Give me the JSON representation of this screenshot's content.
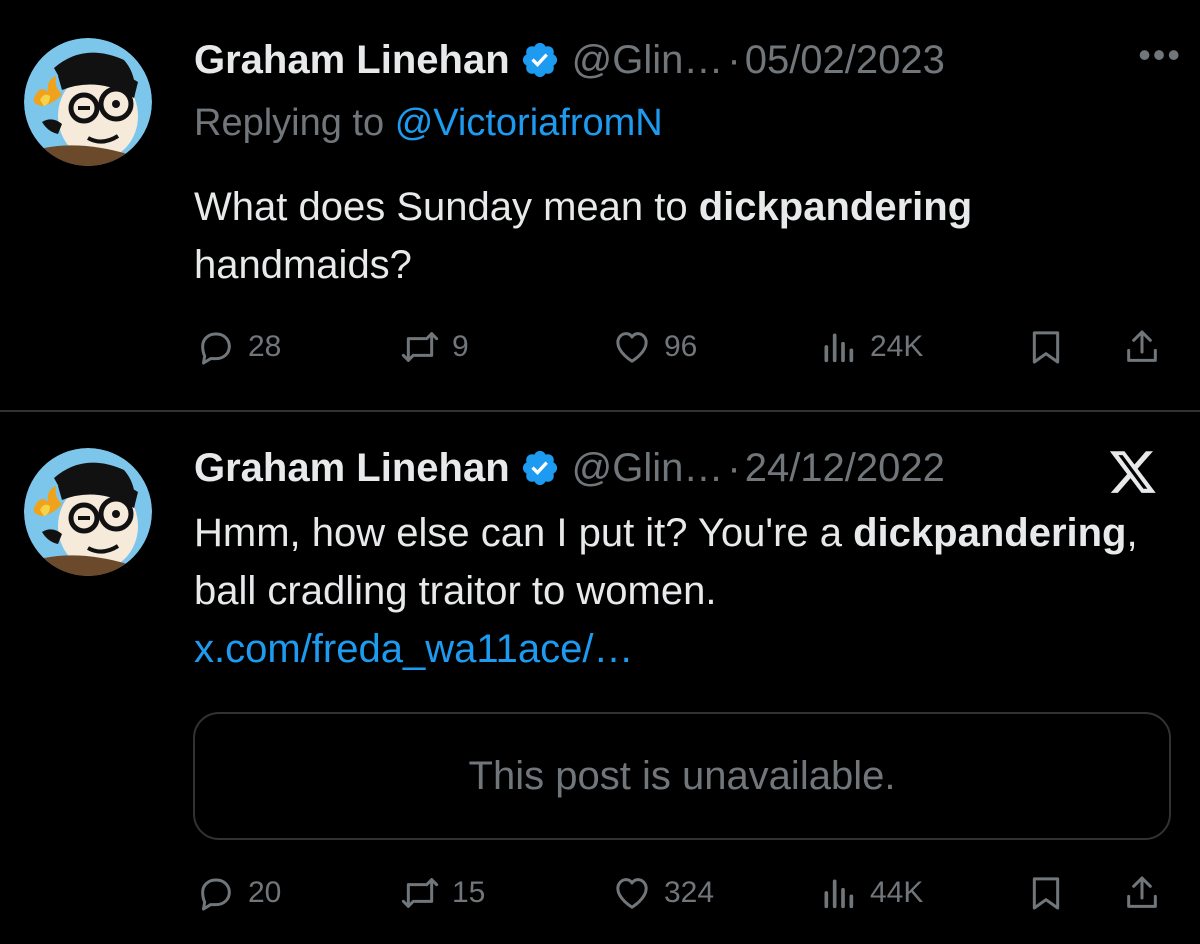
{
  "tweets": [
    {
      "author": "Graham Linehan",
      "handle": "@Glin…",
      "separator": "·",
      "date": "05/02/2023",
      "more_label": "•••",
      "reply_prefix": "Replying to",
      "reply_to": "@VictoriafromN",
      "text_before": "What does Sunday mean to ",
      "text_bold": "dickpandering",
      "text_after": " handmaids?",
      "stats": {
        "replies": "28",
        "reposts": "9",
        "likes": "96",
        "views": "24K"
      }
    },
    {
      "author": "Graham Linehan",
      "handle": "@Glin…",
      "separator": "·",
      "date": "24/12/2022",
      "text_before": "Hmm, how else can I put it? You're a ",
      "text_bold": "dickpandering",
      "text_after": ", ball cradling traitor to women. ",
      "link": "x.com/freda_wa11ace/…",
      "quote_text": "This post is unavailable.",
      "stats": {
        "replies": "20",
        "reposts": "15",
        "likes": "324",
        "views": "44K"
      }
    }
  ],
  "colors": {
    "background": "#000000",
    "text": "#e7e9ea",
    "muted": "#71767b",
    "link": "#1d9bf0",
    "verified": "#1d9bf0",
    "border": "#2f3336"
  },
  "icons": [
    "avatar",
    "verified-badge-icon",
    "more-icon",
    "x-logo-icon",
    "reply-icon",
    "repost-icon",
    "like-icon",
    "views-icon",
    "bookmark-icon",
    "share-icon"
  ]
}
